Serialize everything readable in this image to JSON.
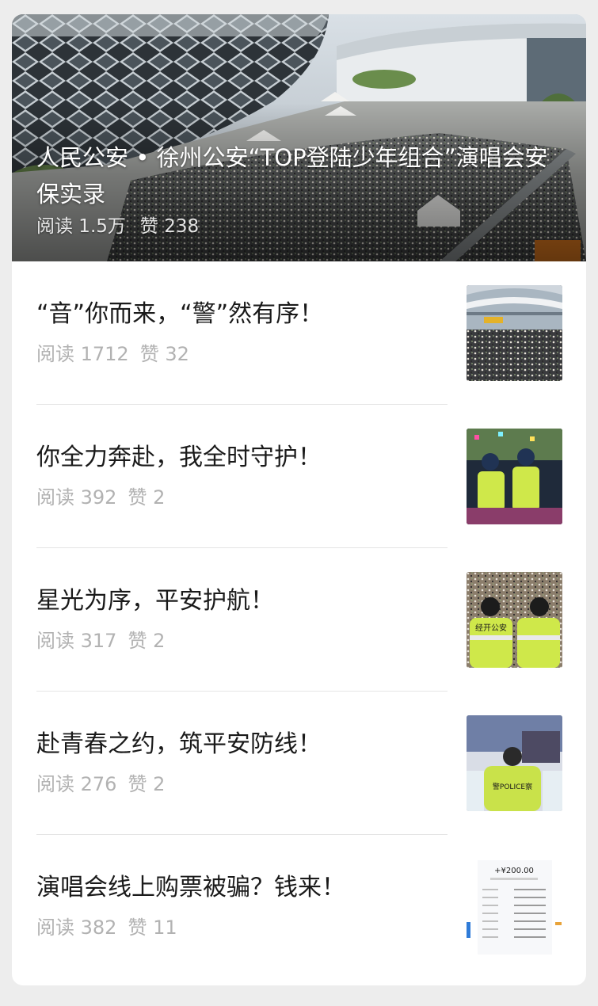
{
  "hero": {
    "title": "人民公安 • 徐州公安“TOP登陆少年组合”演唱会安保实录",
    "read_label": "阅读 1.5万",
    "like_label": "赞 238"
  },
  "articles": [
    {
      "title": "“音”你而来，“警”然有序！",
      "read_label": "阅读 1712",
      "like_label": "赞 32"
    },
    {
      "title": "你全力奔赴，我全时守护！",
      "read_label": "阅读 392",
      "like_label": "赞 2"
    },
    {
      "title": "星光为序，平安护航！",
      "read_label": "阅读 317",
      "like_label": "赞 2"
    },
    {
      "title": "赴青春之约，筑平安防线！",
      "read_label": "阅读 276",
      "like_label": "赞 2"
    },
    {
      "title": "演唱会线上购票被骗？钱来！",
      "read_label": "阅读 382",
      "like_label": "赞 11"
    }
  ],
  "thumbnails": {
    "t3": {
      "vest_text": "经开公安"
    },
    "t4": {
      "vest_text": "警POLICE察"
    },
    "t5": {
      "amount": "+¥200.00"
    }
  },
  "colors": {
    "background": "#ededed",
    "card": "#ffffff",
    "title": "#1a1a1a",
    "meta": "#b2b2b2",
    "divider": "#e5e5e5"
  }
}
